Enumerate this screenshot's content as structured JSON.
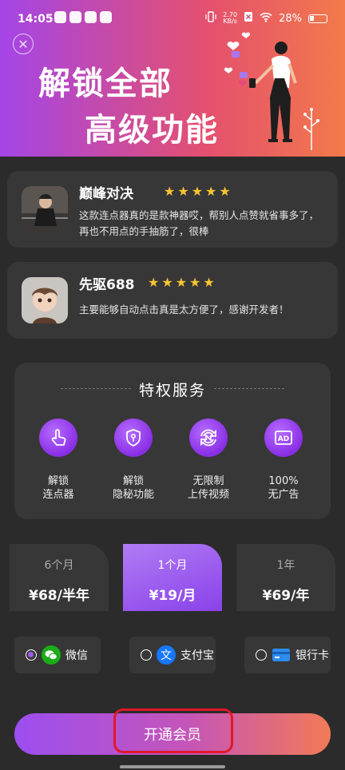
{
  "status": {
    "time": "14:05",
    "net_speed_value": "2.70",
    "net_speed_unit": "KB/s",
    "battery": "28%"
  },
  "hero": {
    "line1": "解锁全部",
    "line2": "高级功能"
  },
  "reviews": [
    {
      "name": "巅峰对决",
      "stars": "★★★★★",
      "text": "这款连点器真的是款神器哎，帮别人点赞就省事多了，再也不用点的手抽筋了，很棒"
    },
    {
      "name": "先驱688",
      "stars": "★★★★★",
      "text": "主要能够自动点击真是太方便了，感谢开发者！"
    }
  ],
  "privileges": {
    "title": "特权服务",
    "items": [
      {
        "line1": "解锁",
        "line2": "连点器",
        "icon": "hand-tap-icon"
      },
      {
        "line1": "解锁",
        "line2": "隐秘功能",
        "icon": "shield-icon"
      },
      {
        "line1": "无限制",
        "line2": "上传视频",
        "icon": "refresh-n-icon"
      },
      {
        "line1": "100%",
        "line2": "无广告",
        "icon": "no-ad-icon"
      }
    ]
  },
  "plans": [
    {
      "duration": "6个月",
      "price": "¥68/半年",
      "selected": false
    },
    {
      "duration": "1个月",
      "price": "¥19/月",
      "selected": true
    },
    {
      "duration": "1年",
      "price": "¥69/年",
      "selected": false
    }
  ],
  "payment": {
    "options": [
      {
        "label": "微信",
        "icon": "wechat-icon",
        "selected": true
      },
      {
        "label": "支付宝",
        "icon": "alipay-icon",
        "selected": false
      },
      {
        "label": "银行卡",
        "icon": "bank-card-icon",
        "selected": false
      }
    ]
  },
  "cta": {
    "label": "开通会员"
  },
  "colors": {
    "accent": "#8a42ea",
    "star": "#f6c533",
    "highlight": "#e0182a"
  }
}
